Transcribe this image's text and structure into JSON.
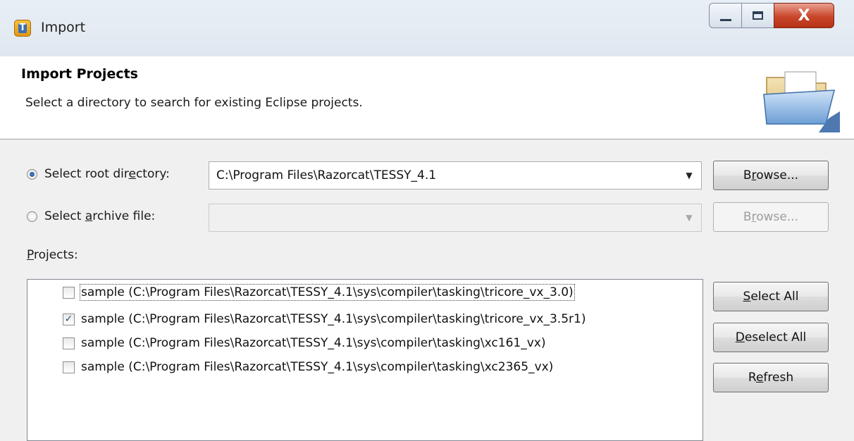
{
  "window": {
    "title": "Import",
    "icon_letter": "T",
    "close_glyph": "X"
  },
  "header": {
    "title": "Import Projects",
    "description": "Select a directory to search for existing Eclipse projects."
  },
  "root_directory": {
    "label_pre": "Select root dir",
    "label_u": "e",
    "label_post": "ctory:",
    "selected": true,
    "value": "C:\\Program Files\\Razorcat\\TESSY_4.1",
    "browse_pre": "B",
    "browse_u": "r",
    "browse_post": "owse..."
  },
  "archive_file": {
    "label_pre": "Select ",
    "label_u": "a",
    "label_post": "rchive file:",
    "selected": false,
    "value": "",
    "browse_pre": "B",
    "browse_u": "r",
    "browse_post": "owse..."
  },
  "projects": {
    "label_u": "P",
    "label_post": "rojects:",
    "items": [
      {
        "label": "sample (C:\\Program Files\\Razorcat\\TESSY_4.1\\sys\\compiler\\tasking\\tricore_vx_3.0)",
        "checked": false
      },
      {
        "label": "sample (C:\\Program Files\\Razorcat\\TESSY_4.1\\sys\\compiler\\tasking\\tricore_vx_3.5r1)",
        "checked": true
      },
      {
        "label": "sample (C:\\Program Files\\Razorcat\\TESSY_4.1\\sys\\compiler\\tasking\\xc161_vx)",
        "checked": false
      },
      {
        "label": "sample (C:\\Program Files\\Razorcat\\TESSY_4.1\\sys\\compiler\\tasking\\xc2365_vx)",
        "checked": false
      }
    ]
  },
  "buttons": {
    "select_all_u": "S",
    "select_all_post": "elect All",
    "deselect_all_u": "D",
    "deselect_all_post": "eselect All",
    "refresh_pre": "R",
    "refresh_u": "e",
    "refresh_post": "fresh"
  },
  "icons": {
    "app": "tessy-app-icon",
    "folder": "open-folder-icon",
    "dropdown": "chevron-down-icon"
  },
  "colors": {
    "close_button": "#c9462c",
    "radio_dot": "#1d4f96",
    "check": "#2a4f8c"
  }
}
